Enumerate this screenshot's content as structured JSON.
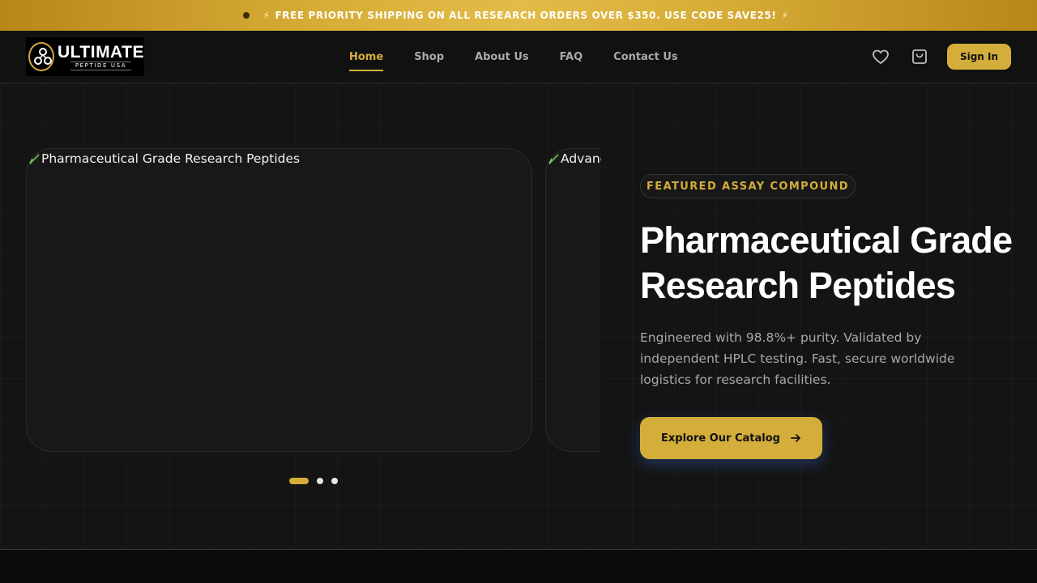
{
  "promo": {
    "text": "FREE PRIORITY SHIPPING ON ALL RESEARCH ORDERS OVER $350. USE CODE SAVE25!",
    "bolt": "⚡"
  },
  "logo": {
    "title": "ULTIMATE",
    "subtitle": "PEPTIDE USA"
  },
  "nav": {
    "items": [
      {
        "label": "Home",
        "active": true
      },
      {
        "label": "Shop",
        "active": false
      },
      {
        "label": "About Us",
        "active": false
      },
      {
        "label": "FAQ",
        "active": false
      },
      {
        "label": "Contact Us",
        "active": false
      }
    ]
  },
  "header": {
    "signin_label": "Sign In",
    "icons": [
      "heart-icon",
      "shopping-bag-icon"
    ]
  },
  "slider": {
    "slides": [
      {
        "alt": "Pharmaceutical Grade Research Peptides"
      },
      {
        "alt": "Advanc"
      }
    ],
    "active_index": 0,
    "count": 3
  },
  "hero": {
    "badge": "FEATURED ASSAY COMPOUND",
    "title": "Pharmaceutical Grade Research Peptides",
    "description": "Engineered with 98.8%+ purity. Validated by independent HPLC testing. Fast, secure worldwide logistics for research facilities.",
    "cta_label": "Explore Our Catalog"
  },
  "colors": {
    "accent": "#d4ae3a",
    "background": "#141414",
    "header": "#111111",
    "promo_gold": "#d6ac35"
  }
}
